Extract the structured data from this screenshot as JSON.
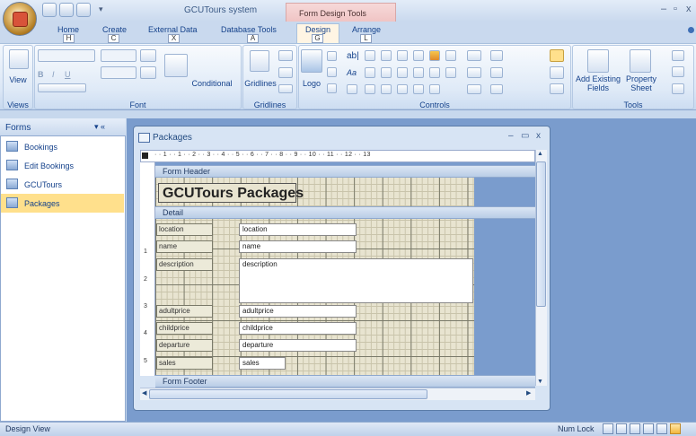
{
  "window": {
    "app_title": "GCUTours system",
    "context_tab_group": "Form Design Tools",
    "minimize": "–",
    "maximize": "▫",
    "close": "x"
  },
  "tabs": [
    {
      "label": "Home",
      "keytip": "H"
    },
    {
      "label": "Create",
      "keytip": "C"
    },
    {
      "label": "External Data",
      "keytip": "X"
    },
    {
      "label": "Database Tools",
      "keytip": "A"
    },
    {
      "label": "Design",
      "keytip": "G"
    },
    {
      "label": "Arrange",
      "keytip": "L"
    }
  ],
  "ribbon": {
    "groups": [
      "Views",
      "Font",
      "Gridlines",
      "Controls",
      "Tools"
    ],
    "view_label": "View",
    "conditional_label": "Conditional",
    "gridlines_label": "Gridlines",
    "logo_label": "Logo",
    "add_fields_label": "Add Existing Fields",
    "property_sheet_label": "Property Sheet",
    "textbox_glyph": "ab|",
    "label_glyph": "Aa"
  },
  "nav": {
    "title": "Forms",
    "controls": "▾ «",
    "items": [
      "Bookings",
      "Edit Bookings",
      "GCUTours",
      "Packages"
    ],
    "selected": "Packages"
  },
  "form_window": {
    "title": "Packages",
    "minimize": "–",
    "restore": "▭",
    "close": "x"
  },
  "ruler_text": "· · 1 · · 1 · · 2 · · 3 · · 4 · · 5 · · 6 · · 7 · · 8 · · 9 · · 10 · · 11 · · 12 · · 13",
  "vruler": [
    "1",
    "2",
    "3",
    "4",
    "5"
  ],
  "sections": {
    "header": "Form Header",
    "detail": "Detail",
    "footer": "Form Footer"
  },
  "form_title": "GCUTours Packages",
  "fields": [
    {
      "label": "location",
      "control": "location"
    },
    {
      "label": "name",
      "control": "name"
    },
    {
      "label": "description",
      "control": "description"
    },
    {
      "label": "adultprice",
      "control": "adultprice"
    },
    {
      "label": "childprice",
      "control": "childprice"
    },
    {
      "label": "departure",
      "control": "departure"
    },
    {
      "label": "sales",
      "control": "sales"
    }
  ],
  "status": {
    "left": "Design View",
    "num_lock": "Num Lock"
  }
}
